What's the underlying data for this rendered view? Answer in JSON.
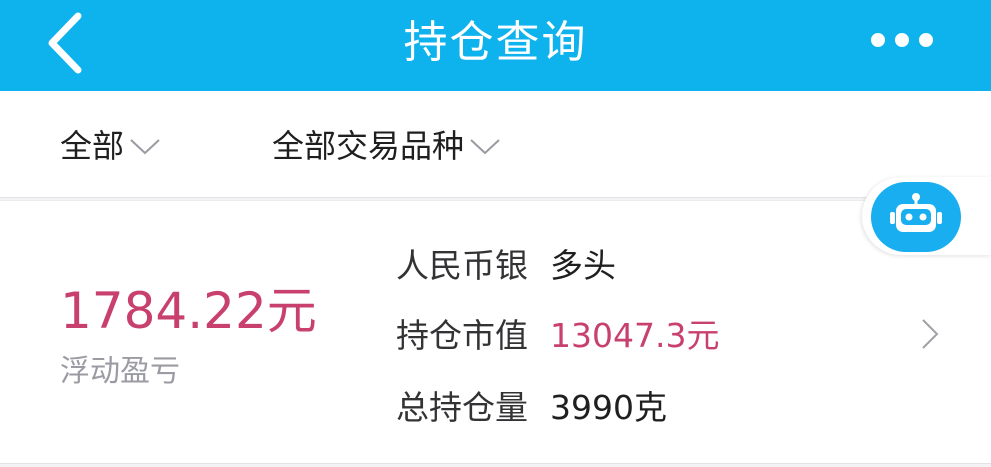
{
  "header": {
    "title": "持仓查询",
    "back_icon": "chevron-left-icon",
    "more_icon": "more-horizontal-icon"
  },
  "filters": [
    {
      "label": "全部",
      "icon": "chevron-down-icon"
    },
    {
      "label": "全部交易品种",
      "icon": "chevron-down-icon"
    }
  ],
  "position": {
    "floating_pl": "1784.22元",
    "floating_pl_label": "浮动盈亏",
    "product_label": "人民币银",
    "direction": "多头",
    "market_value_label": "持仓市值",
    "market_value": "13047.3元",
    "quantity_label": "总持仓量",
    "quantity": "3990克"
  },
  "assistant": {
    "icon": "robot-icon"
  },
  "colors": {
    "header_bg": "#0eb2ec",
    "accent_red": "#c8406d",
    "assistant_blue": "#19aef0"
  }
}
